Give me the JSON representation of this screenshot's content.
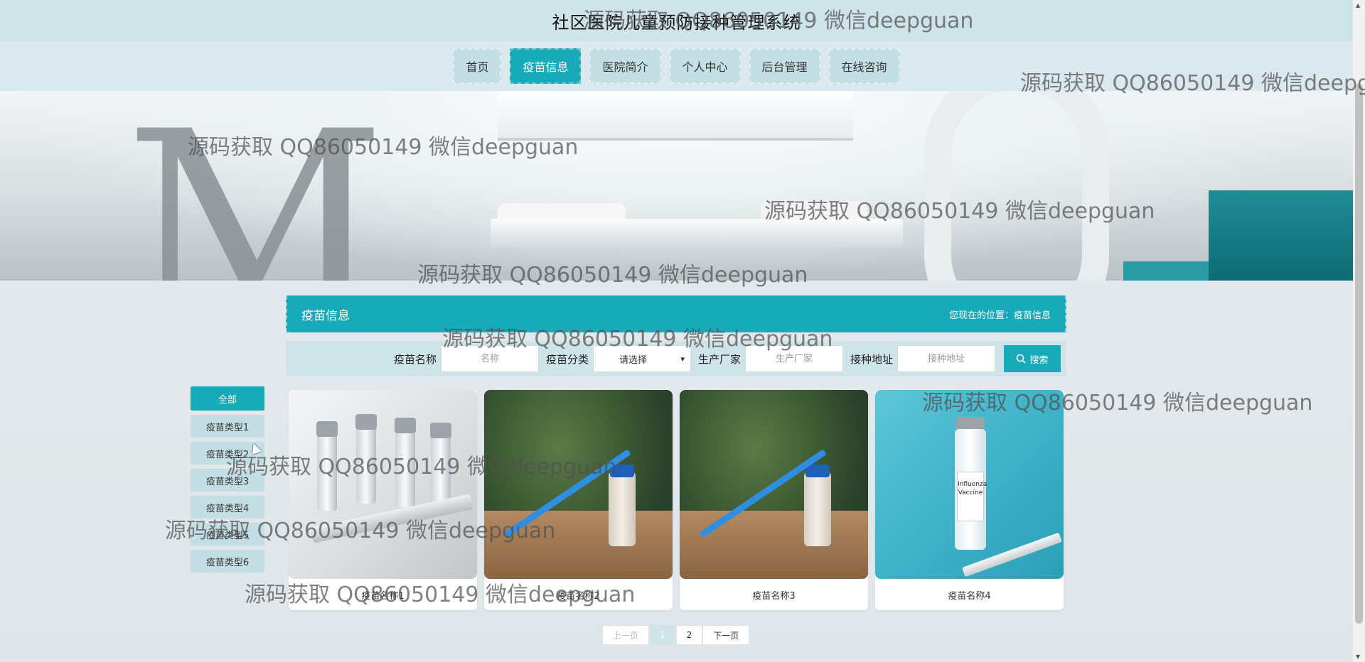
{
  "header": {
    "title": "社区医院儿童预防接种管理系统"
  },
  "nav": {
    "items": [
      {
        "label": "首页"
      },
      {
        "label": "疫苗信息",
        "active": true
      },
      {
        "label": "医院简介"
      },
      {
        "label": "个人中心"
      },
      {
        "label": "后台管理"
      },
      {
        "label": "在线咨询"
      }
    ]
  },
  "content": {
    "section_title": "疫苗信息",
    "breadcrumb_prefix": "您现在的位置：",
    "breadcrumb_current": "疫苗信息"
  },
  "search": {
    "name_label": "疫苗名称",
    "name_placeholder": "名称",
    "category_label": "疫苗分类",
    "category_selected": "请选择",
    "maker_label": "生产厂家",
    "maker_placeholder": "生产厂家",
    "address_label": "接种地址",
    "address_placeholder": "接种地址",
    "button_label": "搜索"
  },
  "categories": [
    {
      "label": "全部",
      "active": true
    },
    {
      "label": "疫苗类型1"
    },
    {
      "label": "疫苗类型2"
    },
    {
      "label": "疫苗类型3"
    },
    {
      "label": "疫苗类型4"
    },
    {
      "label": "疫苗类型5"
    },
    {
      "label": "疫苗类型6"
    }
  ],
  "cards": [
    {
      "name": "疫苗名称1"
    },
    {
      "name": "疫苗名称2"
    },
    {
      "name": "疫苗名称3"
    },
    {
      "name": "疫苗名称4"
    }
  ],
  "pager": {
    "prev": "上一页",
    "pages": [
      "1",
      "2"
    ],
    "current": "1",
    "next": "下一页"
  },
  "watermark": "源码获取 QQ86050149 微信deepguan",
  "vaccine_label": "Influenza Vaccine",
  "colors": {
    "accent": "#17aab8",
    "header_bg": "#cfe4e8",
    "nav_bg": "#dbe9ee"
  }
}
